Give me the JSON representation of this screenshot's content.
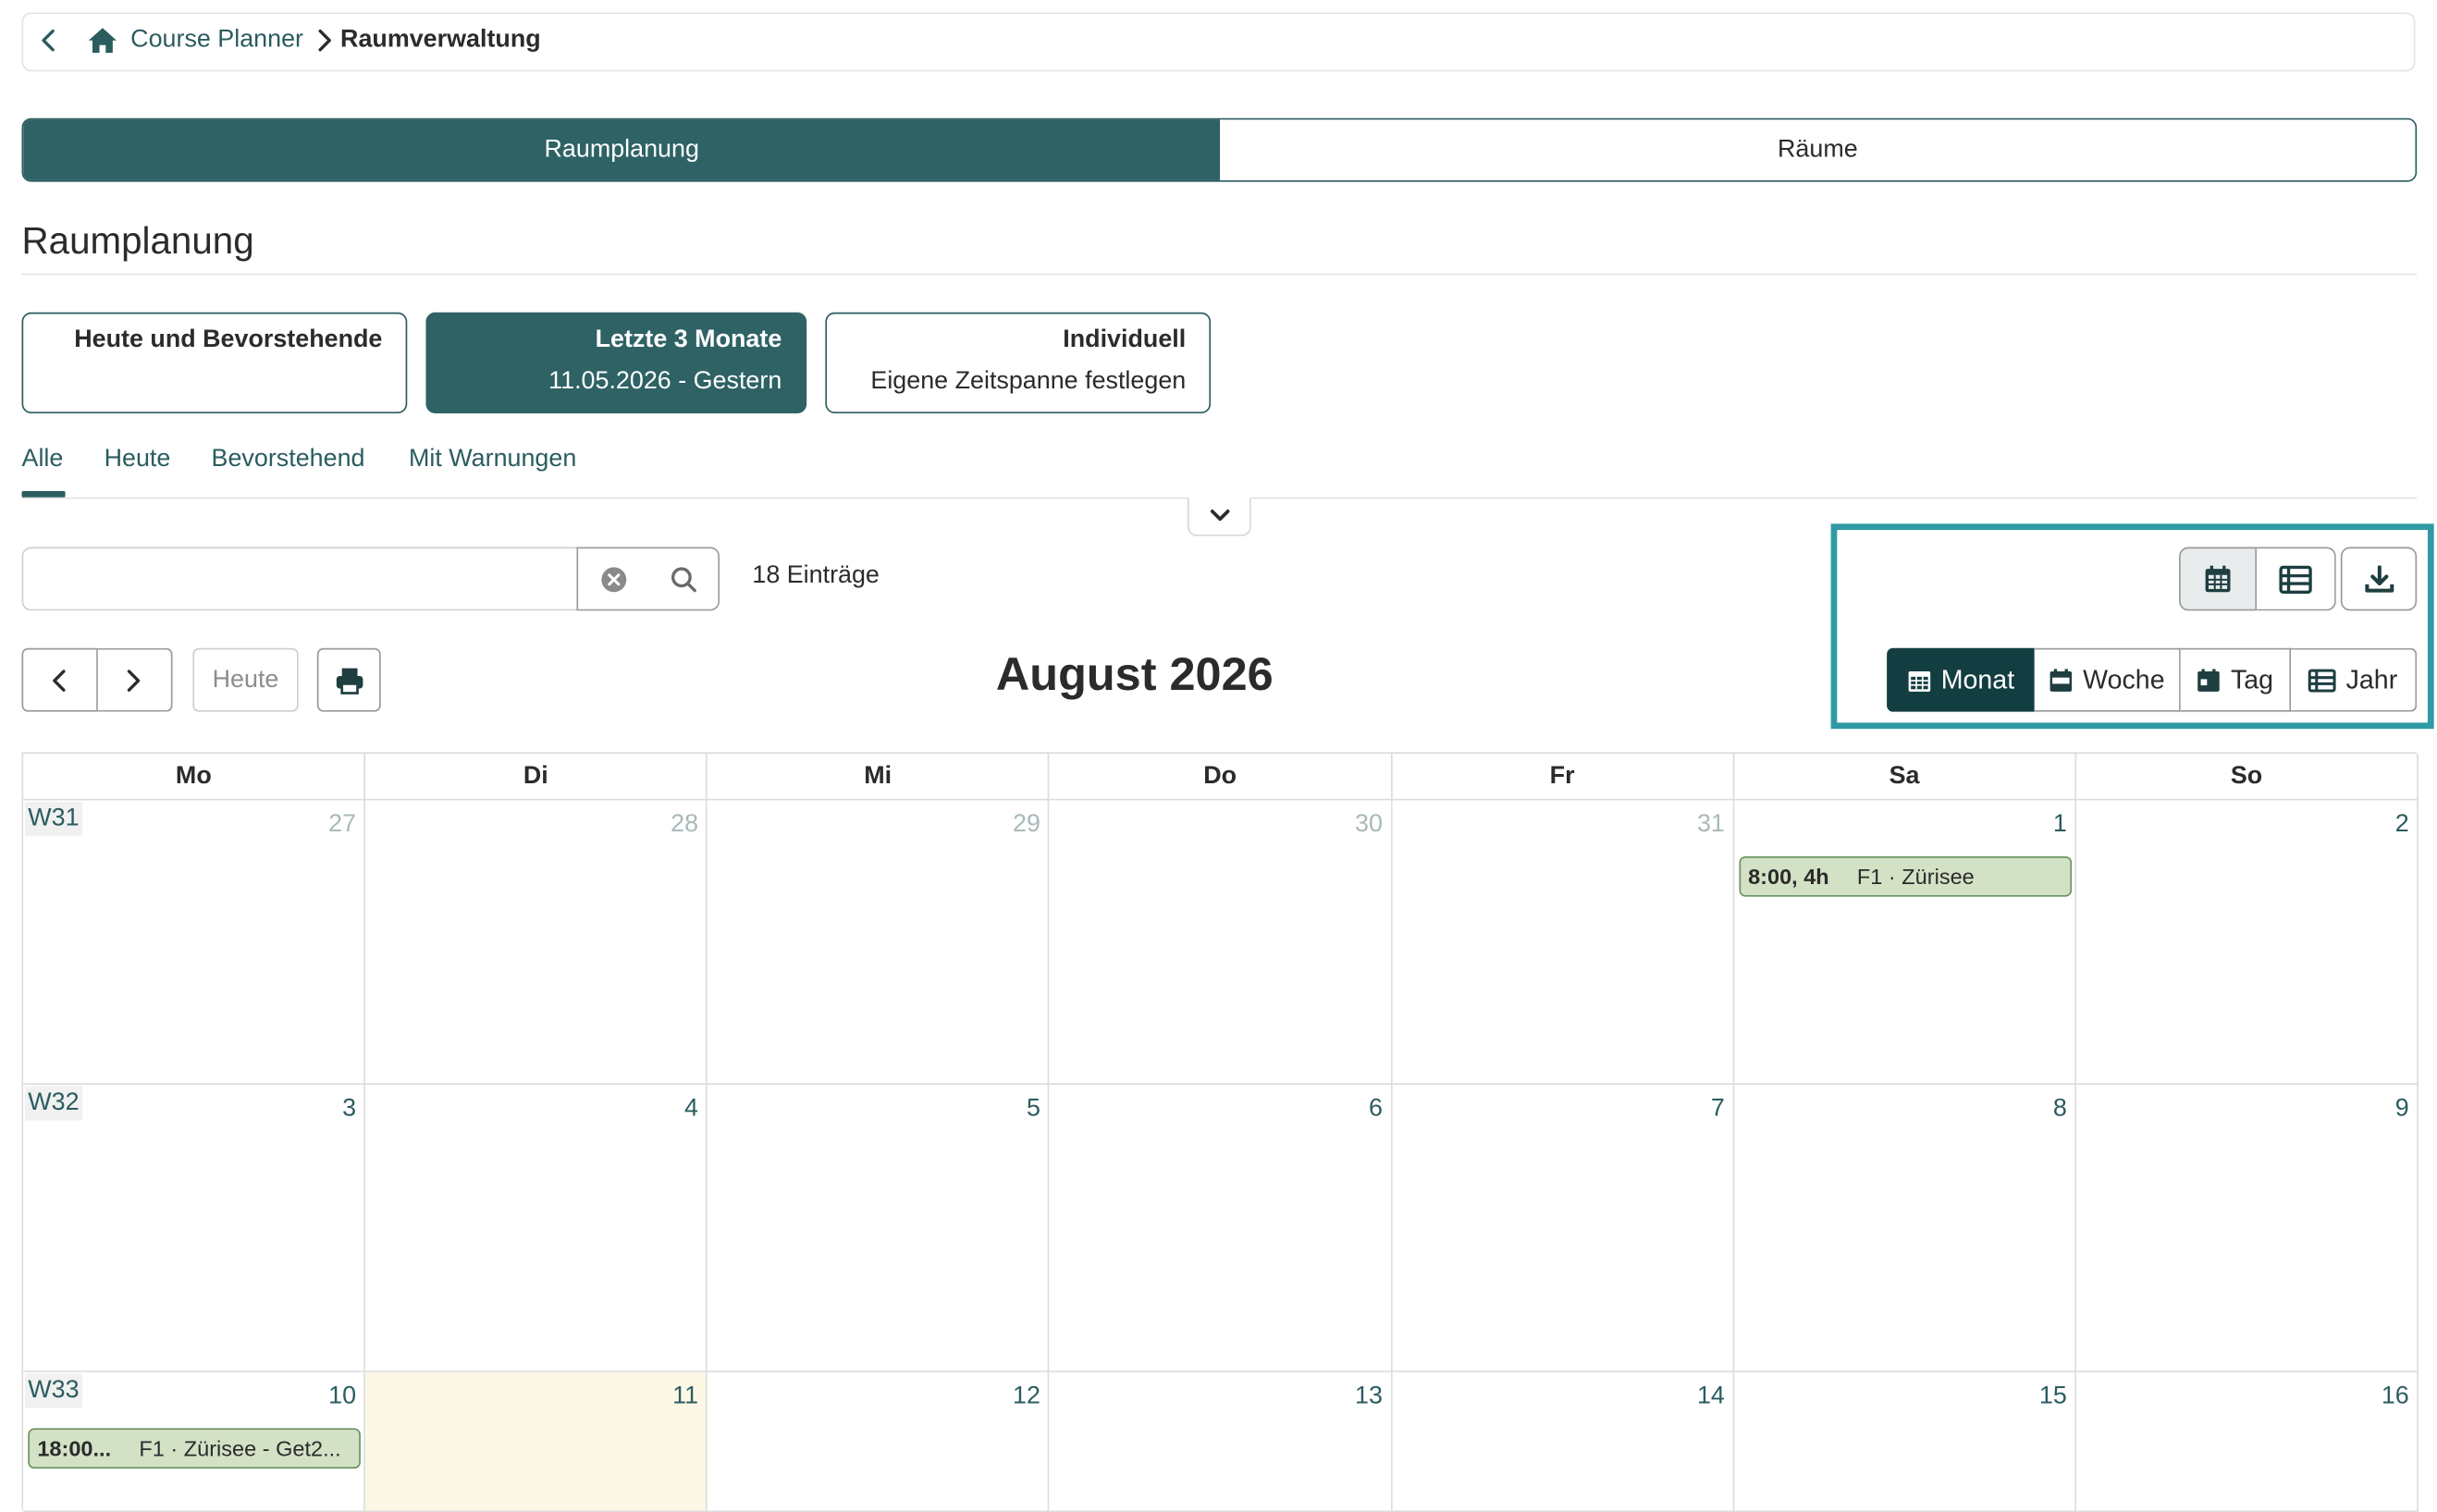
{
  "breadcrumb": {
    "parent": "Course Planner",
    "current": "Raumverwaltung"
  },
  "main_tabs": [
    {
      "label": "Raumplanung",
      "active": true
    },
    {
      "label": "Räume",
      "active": false
    }
  ],
  "page_title": "Raumplanung",
  "range_cards": [
    {
      "title": "Heute und Bevorstehende",
      "subtitle": "",
      "active": false
    },
    {
      "title": "Letzte 3 Monate",
      "subtitle": "11.05.2026 - Gestern",
      "active": true
    },
    {
      "title": "Individuell",
      "subtitle": "Eigene Zeitspanne festlegen",
      "active": false
    }
  ],
  "filter_tabs": [
    "Alle",
    "Heute",
    "Bevorstehend",
    "Mit Warnungen"
  ],
  "filter_active": "Alle",
  "search": {
    "value": "",
    "placeholder": ""
  },
  "entry_count": "18 Einträge",
  "nav": {
    "today_label": "Heute"
  },
  "calendar": {
    "title": "August 2026",
    "view_options": [
      "Monat",
      "Woche",
      "Tag",
      "Jahr"
    ],
    "active_view": "Monat",
    "weekdays": [
      "Mo",
      "Di",
      "Mi",
      "Do",
      "Fr",
      "Sa",
      "So"
    ],
    "weeks": [
      {
        "label": "W31",
        "days": [
          "27",
          "28",
          "29",
          "30",
          "31",
          "1",
          "2"
        ],
        "muted": [
          true,
          true,
          true,
          true,
          true,
          false,
          false
        ]
      },
      {
        "label": "W32",
        "days": [
          "3",
          "4",
          "5",
          "6",
          "7",
          "8",
          "9"
        ],
        "muted": [
          false,
          false,
          false,
          false,
          false,
          false,
          false
        ]
      },
      {
        "label": "W33",
        "days": [
          "10",
          "11",
          "12",
          "13",
          "14",
          "15",
          "16"
        ],
        "muted": [
          false,
          false,
          false,
          false,
          false,
          false,
          false
        ]
      }
    ],
    "today_day": "11",
    "events": [
      {
        "week": 0,
        "day": 5,
        "time": "8:00, 4h",
        "title": "F1 · Zürisee"
      },
      {
        "week": 2,
        "day": 0,
        "time": "18:00...",
        "title": "F1 · Zürisee - Get2..."
      }
    ]
  },
  "colors": {
    "primary": "#2e6265",
    "dark": "#133e41",
    "highlight": "#2f9aa3",
    "event_bg": "#d3e1c5",
    "today_bg": "#fdf8e6"
  }
}
